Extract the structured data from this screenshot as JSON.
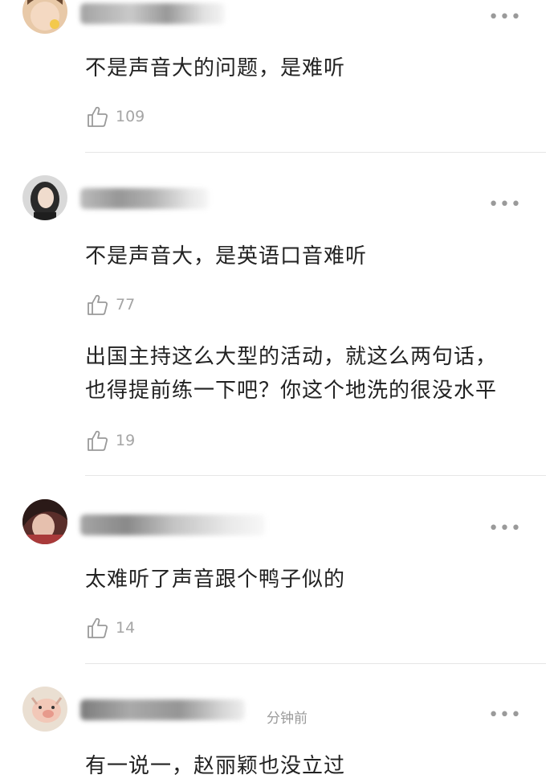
{
  "comments": [
    {
      "text": "不是声音大的问题，是难听",
      "likes": "109",
      "more": "•••"
    },
    {
      "text": "不是声音大，是英语口音难听",
      "likes": "77",
      "more": "•••"
    },
    {
      "text_line1": "出国主持这么大型的活动，就这么两句话，",
      "text_line2": "也得提前练一下吧？你这个地洗的很没水平",
      "likes": "19"
    },
    {
      "text": "太难听了声音跟个鸭子似的",
      "likes": "14",
      "more": "•••"
    },
    {
      "meta": "分钟前",
      "text": "有一说一，赵丽颖也没立过",
      "more": "•••"
    }
  ],
  "icons": {
    "like": "thumbs-up-icon",
    "more": "more-dots-icon"
  }
}
